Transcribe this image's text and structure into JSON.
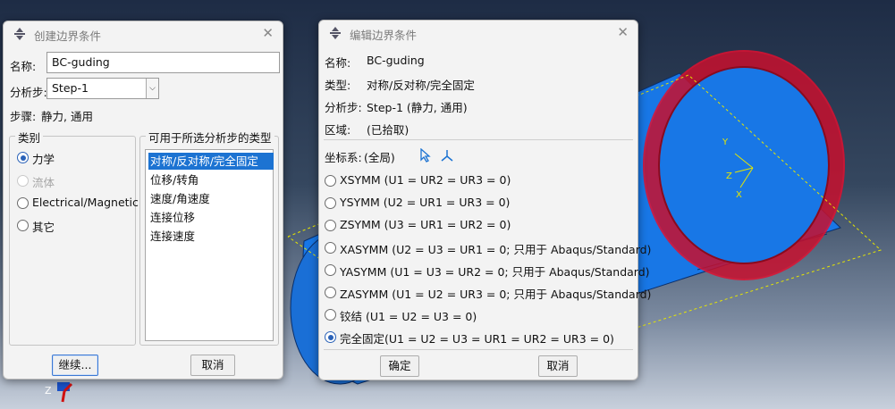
{
  "colors": {
    "accent": "#1c73d2",
    "cylinder": "#1877e6",
    "boundary_ring": "#c8102e",
    "csys_yellow": "#e6e600"
  },
  "viewport": {
    "csys_labels": {
      "y": "Y",
      "z": "Z",
      "x": "X"
    },
    "triad_label": "Z"
  },
  "create_dialog": {
    "title": "创建边界条件",
    "name_label": "名称:",
    "name_value": "BC-guding",
    "step_label": "分析步:",
    "step_value": "Step-1",
    "procedure_label": "步骤:",
    "procedure_value": "静力, 通用",
    "category_group": "类别",
    "categories": [
      {
        "label": "力学",
        "selected": true,
        "enabled": true
      },
      {
        "label": "流体",
        "selected": false,
        "enabled": false
      },
      {
        "label": "Electrical/Magnetic",
        "selected": false,
        "enabled": true
      },
      {
        "label": "其它",
        "selected": false,
        "enabled": true
      }
    ],
    "types_group": "可用于所选分析步的类型",
    "types": [
      {
        "label": "对称/反对称/完全固定",
        "selected": true
      },
      {
        "label": "位移/转角",
        "selected": false
      },
      {
        "label": "速度/角速度",
        "selected": false
      },
      {
        "label": "连接位移",
        "selected": false
      },
      {
        "label": "连接速度",
        "selected": false
      }
    ],
    "continue_button": "继续...",
    "cancel_button": "取消"
  },
  "edit_dialog": {
    "title": "编辑边界条件",
    "name_label": "名称:",
    "name_value": "BC-guding",
    "type_label": "类型:",
    "type_value": "对称/反对称/完全固定",
    "step_label": "分析步:",
    "step_value": "Step-1 (静力, 通用)",
    "region_label": "区域:",
    "region_value": "(已拾取)",
    "csys_label": "坐标系:",
    "csys_value": "(全局)",
    "options": [
      {
        "label": "XSYMM (U1 = UR2 = UR3 = 0)",
        "selected": false
      },
      {
        "label": "YSYMM (U2 = UR1 = UR3 = 0)",
        "selected": false
      },
      {
        "label": "ZSYMM (U3 = UR1 = UR2 = 0)",
        "selected": false
      },
      {
        "label": "XASYMM (U2 = U3 = UR1 = 0; 只用于 Abaqus/Standard)",
        "selected": false
      },
      {
        "label": "YASYMM (U1 = U3 = UR2 = 0; 只用于 Abaqus/Standard)",
        "selected": false
      },
      {
        "label": "ZASYMM (U1 = U2 = UR3 = 0; 只用于 Abaqus/Standard)",
        "selected": false
      },
      {
        "label": "铰结 (U1 = U2 = U3 = 0)",
        "selected": false
      },
      {
        "label": "完全固定(U1 = U2 = U3 = UR1 = UR2 = UR3 = 0)",
        "selected": true
      }
    ],
    "ok_button": "确定",
    "cancel_button": "取消"
  }
}
